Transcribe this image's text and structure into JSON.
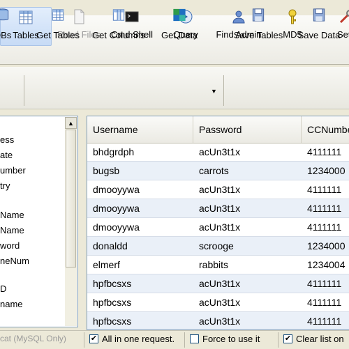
{
  "main_toolbar": {
    "tables": "Tables",
    "read_files": "Read Files",
    "cmd_shell": "Cmd Shell",
    "query": "Query",
    "find_admin": "Find Admin",
    "md5": "MD5",
    "settings": "Setti"
  },
  "sub_toolbar": {
    "dbs": "DBs",
    "get_tables": "Get Tables",
    "get_columns": "Get Columns",
    "get_data": "Get Data",
    "save_tables": "Save Tables",
    "save_data": "Save Data"
  },
  "left_list": {
    "items": [
      "ess",
      "ate",
      "umber",
      "try",
      "",
      "Name",
      "Name",
      "word",
      "neNum",
      "",
      "D",
      "name"
    ]
  },
  "grid": {
    "columns": [
      "Username",
      "Password",
      "CCNumbe"
    ],
    "rows": [
      [
        "bhdgrdph",
        "acUn3t1x",
        "4111111"
      ],
      [
        "bugsb",
        "carrots",
        "1234000"
      ],
      [
        "dmooyywa",
        "acUn3t1x",
        "4111111"
      ],
      [
        "dmooyywa",
        "acUn3t1x",
        "4111111"
      ],
      [
        "dmooyywa",
        "acUn3t1x",
        "4111111"
      ],
      [
        "donaldd",
        "scrooge",
        "1234000"
      ],
      [
        "elmerf",
        "rabbits",
        "1234004"
      ],
      [
        "hpfbcsxs",
        "acUn3t1x",
        "4111111"
      ],
      [
        "hpfbcsxs",
        "acUn3t1x",
        "4111111"
      ],
      [
        "hpfbcsxs",
        "acUn3t1x",
        "4111111"
      ]
    ]
  },
  "status": {
    "mode": "cat (MySQL Only)",
    "all_in_one": "All in one request.",
    "all_in_one_checked": true,
    "force_use": "Force to use it",
    "force_use_checked": false,
    "clear_list": "Clear list on",
    "clear_list_checked": true
  },
  "colors": {
    "active_tab": "#c7dbf6",
    "grid_alt_row": "#eaf0f8",
    "grid_border": "#7f9db9"
  }
}
